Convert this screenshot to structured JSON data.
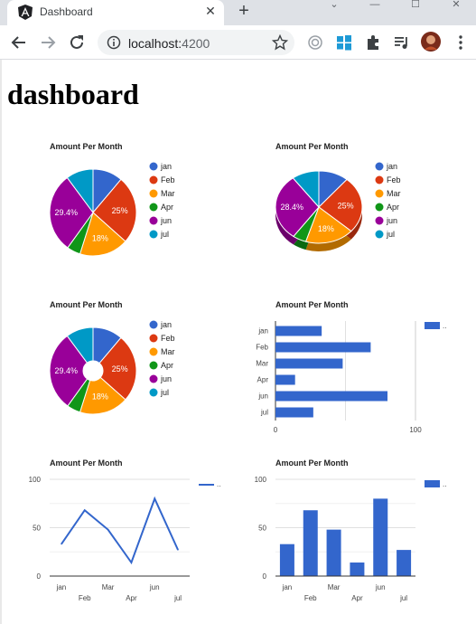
{
  "browser": {
    "tab_title": "Dashboard",
    "tab_close": "✕",
    "new_tab": "+",
    "url_host": "localhost:",
    "url_port": "4200",
    "toolbar_icons": [
      "back-arrow-icon",
      "forward-arrow-icon",
      "reload-icon",
      "info-icon",
      "star-icon",
      "extension-sync-icon",
      "windows-icon",
      "puzzle-extensions-icon",
      "media-queue-icon",
      "profile-avatar",
      "more-menu-icon"
    ]
  },
  "page": {
    "title": "dashboard"
  },
  "colors": {
    "jan": "#3366cc",
    "Feb": "#dc3912",
    "Mar": "#ff9900",
    "Apr": "#109618",
    "jun": "#990099",
    "jul": "#0099c6",
    "bar": "#3366cc",
    "grid": "#e0e0e0"
  },
  "chart_data": [
    {
      "type": "pie",
      "variant": "flat",
      "title": "Amount Per Month",
      "categories": [
        "jan",
        "Feb",
        "Mar",
        "Apr",
        "jun",
        "jul"
      ],
      "values": [
        11,
        25,
        18,
        5,
        29.4,
        10
      ],
      "slice_labels": [
        "",
        "25%",
        "18%",
        "",
        "29.4%",
        ""
      ],
      "legend": "right"
    },
    {
      "type": "pie",
      "variant": "3d",
      "title": "Amount Per Month",
      "categories": [
        "jan",
        "Feb",
        "Mar",
        "Apr",
        "jun",
        "jul"
      ],
      "values": [
        11,
        25,
        18,
        5,
        29.4,
        10
      ],
      "slice_labels": [
        "",
        "25%",
        "18%",
        "",
        "28.4%",
        ""
      ],
      "legend": "right"
    },
    {
      "type": "pie",
      "variant": "donut",
      "title": "Amount Per Month",
      "categories": [
        "jan",
        "Feb",
        "Mar",
        "Apr",
        "jun",
        "jul"
      ],
      "values": [
        11,
        25,
        18,
        5,
        29.4,
        10
      ],
      "slice_labels": [
        "",
        "25%",
        "18%",
        "",
        "29.4%",
        ""
      ],
      "legend": "right"
    },
    {
      "type": "bar",
      "orientation": "horizontal",
      "title": "Amount Per Month",
      "categories": [
        "jan",
        "Feb",
        "Mar",
        "Apr",
        "jun",
        "jul"
      ],
      "values": [
        33,
        68,
        48,
        14,
        80,
        27
      ],
      "xlim": [
        0,
        100
      ],
      "xticks": [
        "0",
        "100"
      ],
      "legend": "top-right",
      "grid": true
    },
    {
      "type": "line",
      "title": "Amount Per Month",
      "categories": [
        "jan",
        "Feb",
        "Mar",
        "Apr",
        "jun",
        "jul"
      ],
      "values": [
        33,
        68,
        48,
        14,
        80,
        27
      ],
      "ylim": [
        0,
        100
      ],
      "yticks": [
        "0",
        "50",
        "100"
      ],
      "legend": "top-right",
      "grid": true
    },
    {
      "type": "bar",
      "orientation": "vertical",
      "title": "Amount Per Month",
      "categories": [
        "jan",
        "Feb",
        "Mar",
        "Apr",
        "jun",
        "jul"
      ],
      "values": [
        33,
        68,
        48,
        14,
        80,
        27
      ],
      "ylim": [
        0,
        100
      ],
      "yticks": [
        "0",
        "50",
        "100"
      ],
      "legend": "top-right",
      "grid": true
    }
  ]
}
